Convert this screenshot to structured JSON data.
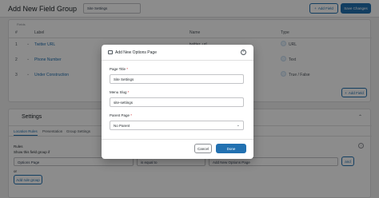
{
  "header": {
    "title": "Add New Field Group",
    "title_input_value": "Site Settings",
    "add_field_label": "Add Field",
    "save_label": "Save Changes"
  },
  "fields": {
    "toggle_label": "Fields",
    "columns": [
      "#",
      "Label",
      "Name",
      "Type"
    ],
    "rows": [
      {
        "num": "1",
        "label": "Twitter URL",
        "name": "twitter_url",
        "type": "URL"
      },
      {
        "num": "2",
        "label": "Phone Number",
        "name": "phone_number",
        "type": "Text"
      },
      {
        "num": "3",
        "label": "Under Construction",
        "name": "under_construction",
        "type": "True / False"
      }
    ],
    "add_field_label": "Add Field"
  },
  "settings": {
    "title": "Settings",
    "tabs": [
      "Location Rules",
      "Presentation",
      "Group Settings"
    ],
    "rules_label": "Rules",
    "show_if_label": "Show this field group if",
    "rule": {
      "param": "Options Page",
      "operator": "is equal to",
      "value": "Add New Options Page"
    },
    "and_label": "and",
    "or_label": "or",
    "add_rule_group_label": "Add rule group"
  },
  "modal": {
    "title": "Add New Options Page",
    "page_title_label": "Page Title",
    "page_title_value": "Site Settings",
    "menu_slug_label": "Menu Slug",
    "menu_slug_value": "site-settings",
    "parent_page_label": "Parent Page",
    "parent_page_value": "No Parent",
    "required_mark": "*",
    "cancel_label": "Cancel",
    "done_label": "Done"
  }
}
